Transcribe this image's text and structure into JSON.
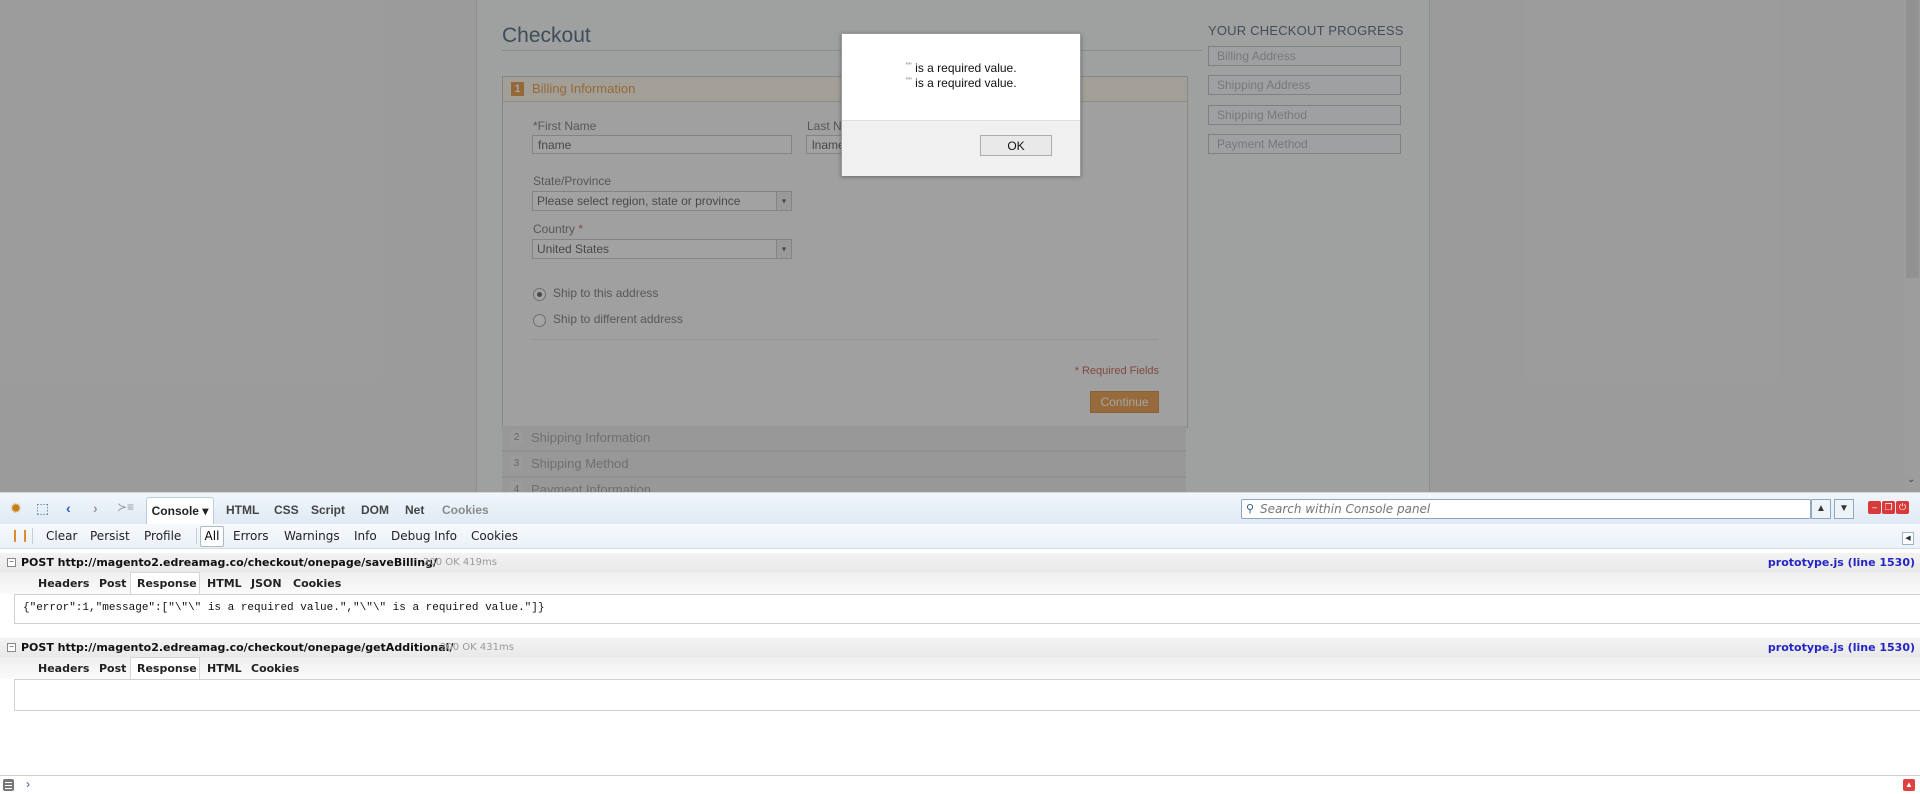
{
  "page": {
    "title": "Checkout",
    "billing": {
      "step_number": "1",
      "title": "Billing Information",
      "first_name_label": "*First Name",
      "first_name_value": "fname",
      "last_name_label": "Last Name",
      "last_name_value": "lname",
      "state_label": "State/Province",
      "state_value": "Please select region, state or province",
      "country_label": "Country",
      "country_required": "*",
      "country_value": "United States",
      "ship_same_label": "Ship to this address",
      "ship_diff_label": "Ship to different address",
      "ship_selected": "same",
      "required_note": "* Required Fields",
      "continue_label": "Continue"
    },
    "steps": [
      {
        "number": "2",
        "label": "Shipping Information"
      },
      {
        "number": "3",
        "label": "Shipping Method"
      },
      {
        "number": "4",
        "label": "Payment Information"
      }
    ],
    "progress": {
      "title": "YOUR CHECKOUT PROGRESS",
      "items": [
        "Billing Address",
        "Shipping Address",
        "Shipping Method",
        "Payment Method"
      ]
    }
  },
  "alert": {
    "quote_glyph": "\"\"",
    "lines": [
      "is a required value.",
      "is a required value."
    ],
    "ok_label": "OK"
  },
  "firebug": {
    "tabs": {
      "console": "Console ▾",
      "html": "HTML",
      "css": "CSS",
      "script": "Script",
      "dom": "DOM",
      "net": "Net",
      "cookies": "Cookies"
    },
    "search_placeholder": "Search within Console panel",
    "subbar": {
      "clear": "Clear",
      "persist": "Persist",
      "profile": "Profile",
      "all": "All",
      "errors": "Errors",
      "warnings": "Warnings",
      "info": "Info",
      "debug_info": "Debug Info",
      "cookies": "Cookies"
    },
    "requests": [
      {
        "method_url": "POST http://magento2.edreamag.co/checkout/onepage/saveBilling/",
        "status": "200 OK 419ms",
        "source": "prototype.js (line 1530)",
        "tabs": [
          "Headers",
          "Post",
          "Response",
          "HTML",
          "JSON",
          "Cookies"
        ],
        "active_tab": "Response",
        "response": "{\"error\":1,\"message\":[\"\\\"\\\" is a required value.\",\"\\\"\\\" is a required value.\"]}"
      },
      {
        "method_url": "POST http://magento2.edreamag.co/checkout/onepage/getAdditional/",
        "status": "200 OK 431ms",
        "source": "prototype.js (line 1530)",
        "tabs": [
          "Headers",
          "Post",
          "Response",
          "HTML",
          "Cookies"
        ],
        "active_tab": "Response",
        "response": ""
      }
    ],
    "command_prompt": "›"
  },
  "colors": {
    "accent_orange": "#e07d12",
    "link_blue": "#2424c6",
    "required_red": "#b3361e"
  }
}
